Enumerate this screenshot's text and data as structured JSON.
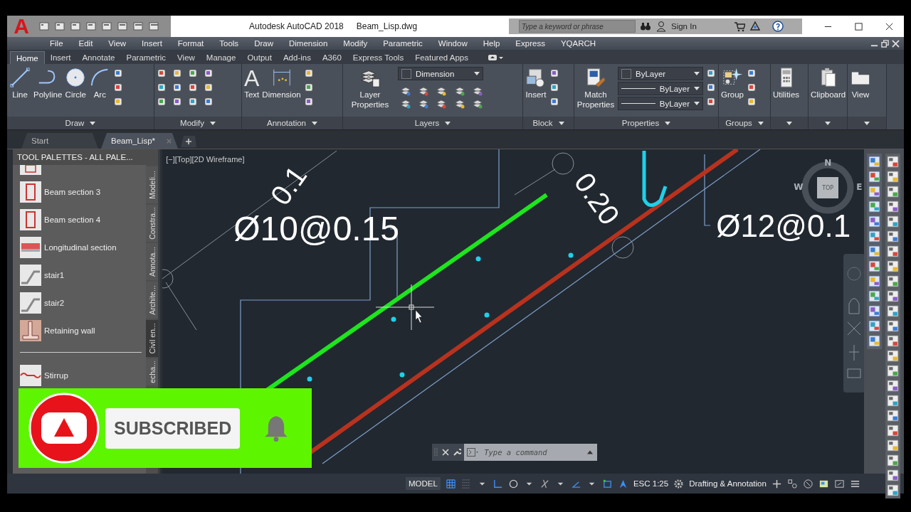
{
  "app_button": {
    "glyph": "A"
  },
  "window": {
    "app_title": "Autodesk AutoCAD 2018",
    "file_name": "Beam_Lisp.dwg"
  },
  "search": {
    "placeholder": "Type a keyword or phrase"
  },
  "account": {
    "label": "Sign In"
  },
  "menu": [
    "File",
    "Edit",
    "View",
    "Insert",
    "Format",
    "Tools",
    "Draw",
    "Dimension",
    "Modify",
    "Parametric",
    "Window",
    "Help",
    "Express",
    "YQARCH"
  ],
  "ribbon_tabs": [
    {
      "label": "Home",
      "selected": true
    },
    {
      "label": "Insert",
      "selected": false
    },
    {
      "label": "Annotate",
      "selected": false
    },
    {
      "label": "Parametric",
      "selected": false
    },
    {
      "label": "View",
      "selected": false
    },
    {
      "label": "Manage",
      "selected": false
    },
    {
      "label": "Output",
      "selected": false
    },
    {
      "label": "Add-ins",
      "selected": false
    },
    {
      "label": "A360",
      "selected": false
    },
    {
      "label": "Express Tools",
      "selected": false
    },
    {
      "label": "Featured Apps",
      "selected": false
    }
  ],
  "ribbon_panels": [
    {
      "title": "Draw",
      "large_tools": [
        {
          "label": "Line"
        },
        {
          "label": "Polyline"
        },
        {
          "label": "Circle"
        },
        {
          "label": "Arc"
        }
      ]
    },
    {
      "title": "Modify"
    },
    {
      "title": "Annotation",
      "large_tools": [
        {
          "label": "Text",
          "glyph": "A"
        },
        {
          "label": "Dimension"
        }
      ]
    },
    {
      "title": "Layers",
      "large_tools": [
        {
          "label": "Layer Properties"
        }
      ],
      "dropdowns": [
        "Dimension"
      ]
    },
    {
      "title": "Block",
      "large_tools": [
        {
          "label": "Insert"
        }
      ]
    },
    {
      "title": "Properties",
      "large_tools": [
        {
          "label": "Match Properties"
        }
      ],
      "dropdowns": [
        "ByLayer",
        "ByLayer",
        "ByLayer"
      ]
    },
    {
      "title": "Groups",
      "large_tools": [
        {
          "label": "Group"
        }
      ]
    },
    {
      "large_tools": [
        {
          "label": "Utilities"
        }
      ]
    },
    {
      "large_tools": [
        {
          "label": "Clipboard"
        }
      ]
    },
    {
      "large_tools": [
        {
          "label": "View"
        }
      ]
    }
  ],
  "file_tabs": [
    {
      "label": "Start",
      "selected": false
    },
    {
      "label": "Beam_Lisp*",
      "selected": true
    }
  ],
  "tool_palette": {
    "title": "TOOL PALETTES - ALL PALE...",
    "items": [
      {
        "label": "Beam section 3"
      },
      {
        "label": "Beam section 4"
      },
      {
        "label": "Longitudinal section"
      },
      {
        "label": "stair1"
      },
      {
        "label": "stair2"
      },
      {
        "label": "Retaining wall"
      },
      {
        "label": "Stirrup"
      }
    ],
    "side_tabs": [
      {
        "label": "Modeli...",
        "selected": false
      },
      {
        "label": "Constra...",
        "selected": false
      },
      {
        "label": "Annota...",
        "selected": false
      },
      {
        "label": "Archite...",
        "selected": false
      },
      {
        "label": "Civil en...",
        "selected": true
      },
      {
        "label": "echa...",
        "selected": false
      }
    ]
  },
  "viewport": {
    "label": "[−][Top][2D Wireframe]",
    "annotations": [
      "0.1",
      "Ø10@0.15",
      "0.20",
      "Ø12@0.1"
    ],
    "viewcube": {
      "face": "TOP",
      "north": "N",
      "west": "W",
      "east": "E"
    }
  },
  "command_line": {
    "placeholder": "Type a command"
  },
  "status_bar": {
    "space": "MODEL",
    "scale": "ESC 1:25",
    "workspace": "Drafting & Annotation"
  },
  "subscribe_overlay": {
    "label": "SUBSCRIBED"
  }
}
